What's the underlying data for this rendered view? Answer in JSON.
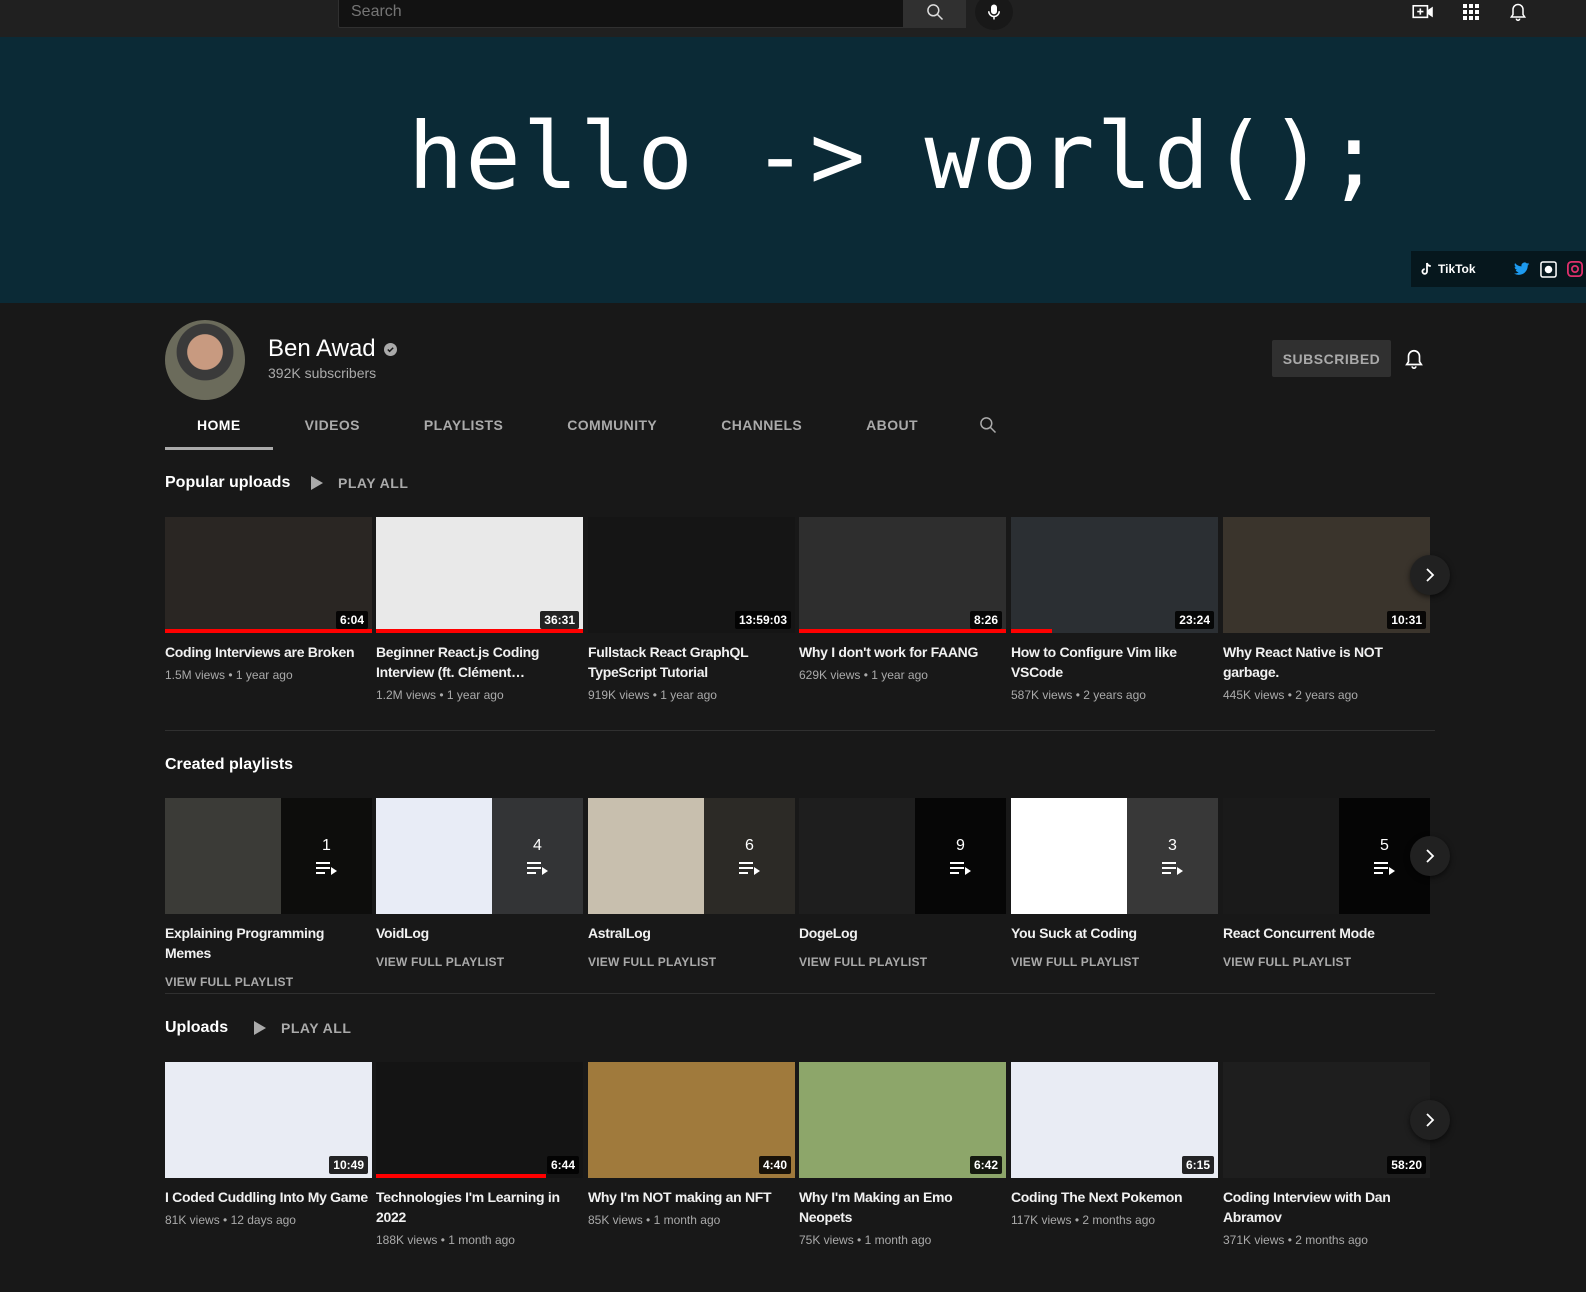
{
  "topbar": {
    "search_placeholder": "Search",
    "icons": [
      "search-icon",
      "mic-icon",
      "create-video-icon",
      "apps-icon",
      "notifications-icon"
    ]
  },
  "banner": {
    "text": "hello -> world();",
    "links": [
      {
        "label": "TikTok",
        "icon": "tiktok-icon"
      },
      {
        "icon": "twitter-icon"
      },
      {
        "icon": "github-icon"
      },
      {
        "icon": "instagram-icon"
      }
    ]
  },
  "channel": {
    "name": "Ben Awad",
    "subscribers": "392K subscribers",
    "subscribe_label": "SUBSCRIBED",
    "tabs": [
      "HOME",
      "VIDEOS",
      "PLAYLISTS",
      "COMMUNITY",
      "CHANNELS",
      "ABOUT"
    ]
  },
  "popular": {
    "title": "Popular uploads",
    "play_all": "PLAY ALL",
    "videos": [
      {
        "title": "Coding Interviews are Broken",
        "views": "1.5M views",
        "age": "1 year ago",
        "duration": "6:04",
        "progress": 1.0,
        "bg": "#2a2623"
      },
      {
        "title": "Beginner React.js Coding Interview (ft. Clément…",
        "views": "1.2M views",
        "age": "1 year ago",
        "duration": "36:31",
        "progress": 1.0,
        "bg": "#e9e9e9"
      },
      {
        "title": "Fullstack React GraphQL TypeScript Tutorial",
        "views": "919K views",
        "age": "1 year ago",
        "duration": "13:59:03",
        "progress": 0.0,
        "bg": "#151515"
      },
      {
        "title": "Why I don't work for FAANG",
        "views": "629K views",
        "age": "1 year ago",
        "duration": "8:26",
        "progress": 1.0,
        "bg": "#2e2e2e"
      },
      {
        "title": "How to Configure Vim like VSCode",
        "views": "587K views",
        "age": "2 years ago",
        "duration": "23:24",
        "progress": 0.2,
        "bg": "#2b2f33"
      },
      {
        "title": "Why React Native is NOT garbage.",
        "views": "445K views",
        "age": "2 years ago",
        "duration": "10:31",
        "progress": 0.0,
        "bg": "#3a342c"
      }
    ]
  },
  "playlists": {
    "title": "Created playlists",
    "link_label": "VIEW FULL PLAYLIST",
    "items": [
      {
        "title": "Explaining Programming Memes",
        "count": "1",
        "bg": "#3b3b37"
      },
      {
        "title": "VoidLog",
        "count": "4",
        "bg": "#e8ecf6"
      },
      {
        "title": "AstralLog",
        "count": "6",
        "bg": "#c8bfae"
      },
      {
        "title": "DogeLog",
        "count": "9",
        "bg": "#1e1e1e"
      },
      {
        "title": "You Suck at Coding",
        "count": "3",
        "bg": "#ffffff"
      },
      {
        "title": "React Concurrent Mode",
        "count": "5",
        "bg": "#1a1a1a"
      }
    ]
  },
  "uploads": {
    "title": "Uploads",
    "play_all": "PLAY ALL",
    "videos": [
      {
        "title": "I Coded Cuddling Into My Game",
        "views": "81K views",
        "age": "12 days ago",
        "duration": "10:49",
        "progress": 0.0,
        "bg": "#e9ecf4"
      },
      {
        "title": "Technologies I'm Learning in 2022",
        "views": "188K views",
        "age": "1 month ago",
        "duration": "6:44",
        "progress": 0.82,
        "bg": "#141414"
      },
      {
        "title": "Why I'm NOT making an NFT",
        "views": "85K views",
        "age": "1 month ago",
        "duration": "4:40",
        "progress": 0.0,
        "bg": "#a07a3c"
      },
      {
        "title": "Why I'm Making an Emo Neopets",
        "views": "75K views",
        "age": "1 month ago",
        "duration": "6:42",
        "progress": 0.0,
        "bg": "#8da66a"
      },
      {
        "title": "Coding The Next Pokemon",
        "views": "117K views",
        "age": "2 months ago",
        "duration": "6:15",
        "progress": 0.0,
        "bg": "#e9ecf4"
      },
      {
        "title": "Coding Interview with Dan Abramov",
        "views": "371K views",
        "age": "2 months ago",
        "duration": "58:20",
        "progress": 0.0,
        "bg": "#1e1e1e"
      }
    ]
  }
}
